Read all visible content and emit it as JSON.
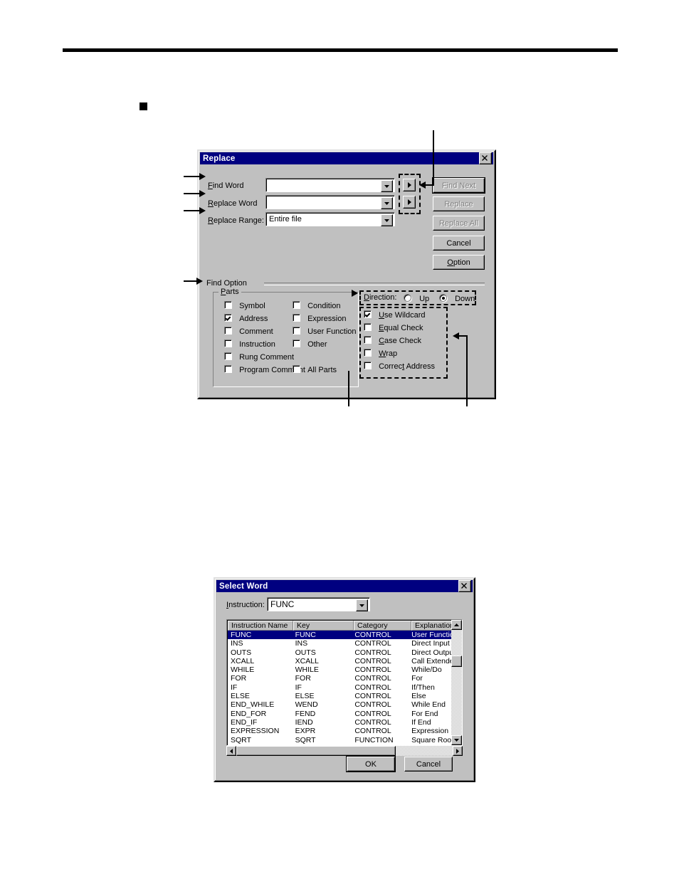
{
  "page": {
    "bullet_marker": "■"
  },
  "replace_dialog": {
    "title": "Replace",
    "close_label": "✕",
    "fields": [
      {
        "label": "Find Word",
        "value": "",
        "accel": "F"
      },
      {
        "label": "Replace Word",
        "value": "",
        "accel": "R"
      },
      {
        "label": "Replace Range:",
        "value": "Entire file",
        "accel": "R"
      }
    ],
    "side_arrow_buttons": [
      {
        "name": "find-word-browse",
        "glyph": "▸"
      },
      {
        "name": "replace-word-browse",
        "glyph": "▸"
      }
    ],
    "buttons": [
      {
        "label": "Find Next",
        "enabled": false
      },
      {
        "label": "Replace",
        "enabled": false
      },
      {
        "label": "Replace All",
        "enabled": false
      },
      {
        "label": "Cancel",
        "enabled": true
      },
      {
        "label": "Option",
        "enabled": true
      }
    ],
    "find_option": {
      "caption": "Find Option",
      "parts_group": {
        "caption": "Parts",
        "column_left": [
          {
            "label": "Symbol",
            "checked": false
          },
          {
            "label": "Address",
            "checked": true
          },
          {
            "label": "Comment",
            "checked": false
          },
          {
            "label": "Instruction",
            "checked": false
          },
          {
            "label": "Rung Comment",
            "checked": false
          },
          {
            "label": "Program Comment",
            "checked": false
          }
        ],
        "column_right": [
          {
            "label": "Condition",
            "checked": false
          },
          {
            "label": "Expression",
            "checked": false
          },
          {
            "label": "User Function",
            "checked": false
          },
          {
            "label": "Other",
            "checked": false
          },
          {
            "label": "All Parts",
            "checked": false
          }
        ]
      },
      "direction": {
        "label": "Direction:",
        "options": [
          {
            "label": "Up",
            "selected": false
          },
          {
            "label": "Down",
            "selected": true
          }
        ]
      },
      "options": [
        {
          "label": "Use Wildcard",
          "checked": true
        },
        {
          "label": "Equal Check",
          "checked": false
        },
        {
          "label": "Case Check",
          "checked": false
        },
        {
          "label": "Wrap",
          "checked": false
        },
        {
          "label": "Correct Address",
          "checked": false
        }
      ]
    }
  },
  "select_word_dialog": {
    "title": "Select Word",
    "close_label": "✕",
    "instruction_label": "Instruction:",
    "instruction_value": "FUNC",
    "columns": [
      "Instruction Name",
      "Key",
      "Category",
      "Explanation"
    ],
    "rows": [
      {
        "name": "FUNC",
        "key": "FUNC",
        "category": "CONTROL",
        "explanation": "User Function",
        "selected": true
      },
      {
        "name": "INS",
        "key": "INS",
        "category": "CONTROL",
        "explanation": "Direct Input St",
        "selected": false
      },
      {
        "name": "OUTS",
        "key": "OUTS",
        "category": "CONTROL",
        "explanation": "Direct Output S",
        "selected": false
      },
      {
        "name": "XCALL",
        "key": "XCALL",
        "category": "CONTROL",
        "explanation": "Call Extended",
        "selected": false
      },
      {
        "name": "WHILE",
        "key": "WHILE",
        "category": "CONTROL",
        "explanation": "While/Do",
        "selected": false
      },
      {
        "name": "FOR",
        "key": "FOR",
        "category": "CONTROL",
        "explanation": "For",
        "selected": false
      },
      {
        "name": "IF",
        "key": "IF",
        "category": "CONTROL",
        "explanation": "If/Then",
        "selected": false
      },
      {
        "name": "ELSE",
        "key": "ELSE",
        "category": "CONTROL",
        "explanation": "Else",
        "selected": false
      },
      {
        "name": "END_WHILE",
        "key": "WEND",
        "category": "CONTROL",
        "explanation": "While End",
        "selected": false
      },
      {
        "name": "END_FOR",
        "key": "FEND",
        "category": "CONTROL",
        "explanation": "For End",
        "selected": false
      },
      {
        "name": "END_IF",
        "key": "IEND",
        "category": "CONTROL",
        "explanation": "If End",
        "selected": false
      },
      {
        "name": "EXPRESSION",
        "key": "EXPR",
        "category": "CONTROL",
        "explanation": "Expression",
        "selected": false
      },
      {
        "name": "SQRT",
        "key": "SQRT",
        "category": "FUNCTION",
        "explanation": "Square Root",
        "selected": false
      }
    ],
    "buttons": [
      {
        "label": "OK"
      },
      {
        "label": "Cancel"
      }
    ]
  },
  "colors": {
    "titlebar": "#000080",
    "dialog_face": "#c0c0c0",
    "selection": "#000080",
    "disabled_text": "#808080"
  }
}
